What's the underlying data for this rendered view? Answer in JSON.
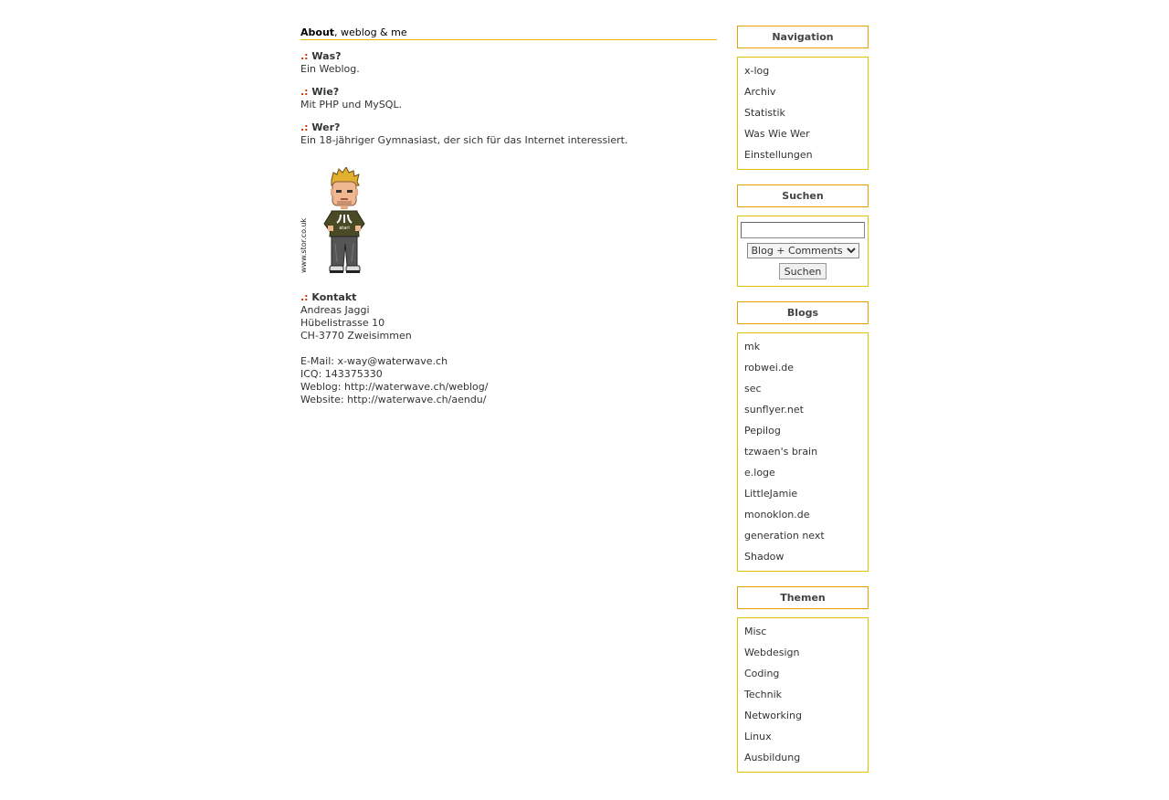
{
  "about": {
    "title_bold": "About",
    "title_rest": ", weblog & me",
    "marker": ".:",
    "qa": [
      {
        "q": "Was?",
        "a": "Ein Weblog."
      },
      {
        "q": "Wie?",
        "a": "Mit PHP und MySQL."
      },
      {
        "q": "Wer?",
        "a": "Ein 18-jähriger Gymnasiast, der sich für das Internet interessiert."
      }
    ],
    "avatar_credit": "www.stor.co.uk",
    "avatar_shirt_text": "atari"
  },
  "contact": {
    "heading": "Kontakt",
    "name": "Andreas Jaggi",
    "street": "Hübelistrasse 10",
    "city": "CH-3770 Zweisimmen",
    "email_label": "E-Mail:",
    "email": "x-way@waterwave.ch",
    "icq_label": "ICQ:",
    "icq": "143375330",
    "weblog_label": "Weblog:",
    "weblog": "http://waterwave.ch/weblog/",
    "website_label": "Website:",
    "website": "http://waterwave.ch/aendu/"
  },
  "sidebar": {
    "navigation": {
      "title": "Navigation",
      "items": [
        "x-log",
        "Archiv",
        "Statistik",
        "Was Wie Wer",
        "Einstellungen"
      ]
    },
    "search": {
      "title": "Suchen",
      "input_value": "",
      "select_value": "Blog + Comments",
      "button_label": "Suchen"
    },
    "blogs": {
      "title": "Blogs",
      "items": [
        "mk",
        "robwei.de",
        "sec",
        "sunflyer.net",
        "Pepilog",
        "tzwaen's brain",
        "e.loge",
        "LittleJamie",
        "monoklon.de",
        "generation next",
        "Shadow"
      ]
    },
    "themen": {
      "title": "Themen",
      "items": [
        "Misc",
        "Webdesign",
        "Coding",
        "Technik",
        "Networking",
        "Linux",
        "Ausbildung"
      ]
    }
  },
  "colors": {
    "accent_border": "#e8a000",
    "marker": "#cc3300",
    "text": "#333333"
  }
}
